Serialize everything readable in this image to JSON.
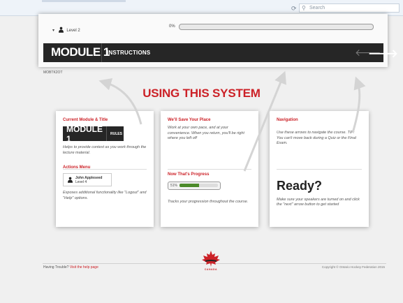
{
  "browser": {
    "refresh_icon": "refresh-icon",
    "search_placeholder": "Search"
  },
  "course": {
    "level_label": "Level 2",
    "progress_percent_label": "0%",
    "progress_value": 0,
    "module_title": "MODULE 1",
    "section_label": "INSTRUCTIONS",
    "code": "MOBTK2OT"
  },
  "heading": "USING THIS SYSTEM",
  "cards": {
    "current_module": {
      "title": "Current Module & Title",
      "badge_module": "MODULE 1",
      "badge_section": "RULES",
      "text": "Helps to provide context as you work through the lecture material."
    },
    "actions_menu": {
      "title": "Actions Menu",
      "user_name": "John Appleseed",
      "user_level": "Level 4",
      "text": "Exposes additional functionality like \"Logout\" and \"Help\" options."
    },
    "save_place": {
      "title": "We'll Save Your Place",
      "text": "Work at your own pace, and at your convenience. When you return, you'll be right where you left off"
    },
    "progress": {
      "title": "Now That's Progress",
      "percent_label": "51%",
      "value": 0.51,
      "text": "Tracks your progression throughout the course."
    },
    "navigation": {
      "title": "Navigation",
      "text": "Use these arrows to navigate the course. TIP: You can't move back during a Quiz or the Final Exam."
    },
    "ready": {
      "title": "Ready?",
      "text": "Make sure your speakers are turned on and click the \"next\" arrow button to get started"
    }
  },
  "footer": {
    "trouble_text": "Having Trouble?",
    "help_link": "Visit the help page",
    "logo_text": "CANADA",
    "copyright": "Copyright © Ontario Hockey Federation 2015"
  },
  "colors": {
    "accent": "#cc2127",
    "dark": "#262626",
    "progress": "#4c8a2a"
  }
}
